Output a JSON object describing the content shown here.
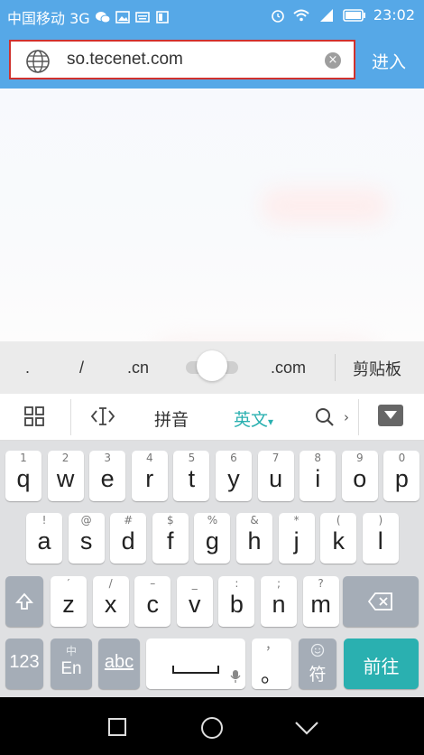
{
  "status_bar": {
    "carrier": "中国移动 3G",
    "time": "23:02",
    "icons": [
      "wechat-icon",
      "image-icon",
      "keyboard-icon",
      "square-icon",
      "alarm-icon",
      "wifi-icon",
      "signal-icon",
      "battery-icon"
    ]
  },
  "address_bar": {
    "url": "so.tecenet.com",
    "clear_symbol": "×",
    "enter_label": "进入"
  },
  "suggestions": {
    "dot": ".",
    "slash": "/",
    "cn": ".cn",
    "com": ".com",
    "clipboard": "剪贴板"
  },
  "ime_toolbar": {
    "pinyin": "拼音",
    "english": "英文",
    "english_arrow": "▾",
    "chevron": "›"
  },
  "keyboard": {
    "row1": [
      {
        "sup": "1",
        "key": "q"
      },
      {
        "sup": "2",
        "key": "w"
      },
      {
        "sup": "3",
        "key": "e"
      },
      {
        "sup": "4",
        "key": "r"
      },
      {
        "sup": "5",
        "key": "t"
      },
      {
        "sup": "6",
        "key": "y"
      },
      {
        "sup": "7",
        "key": "u"
      },
      {
        "sup": "8",
        "key": "i"
      },
      {
        "sup": "9",
        "key": "o"
      },
      {
        "sup": "0",
        "key": "p"
      }
    ],
    "row2": [
      {
        "sup": "!",
        "key": "a"
      },
      {
        "sup": "@",
        "key": "s"
      },
      {
        "sup": "#",
        "key": "d"
      },
      {
        "sup": "$",
        "key": "f"
      },
      {
        "sup": "%",
        "key": "g"
      },
      {
        "sup": "&",
        "key": "h"
      },
      {
        "sup": "*",
        "key": "j"
      },
      {
        "sup": "(",
        "key": "k"
      },
      {
        "sup": ")",
        "key": "l"
      }
    ],
    "row3": [
      {
        "sup": "′",
        "key": "z"
      },
      {
        "sup": "/",
        "key": "x"
      },
      {
        "sup": "–",
        "key": "c"
      },
      {
        "sup": "_",
        "key": "v"
      },
      {
        "sup": ":",
        "key": "b"
      },
      {
        "sup": ";",
        "key": "n"
      },
      {
        "sup": "?",
        "key": "m"
      }
    ],
    "num_label": "123",
    "lang_top": "中",
    "lang_bottom": "En",
    "abc_label": "abc",
    "comma_sup": "，",
    "period": "。",
    "symbol_label": "符",
    "go_label": "前往"
  }
}
